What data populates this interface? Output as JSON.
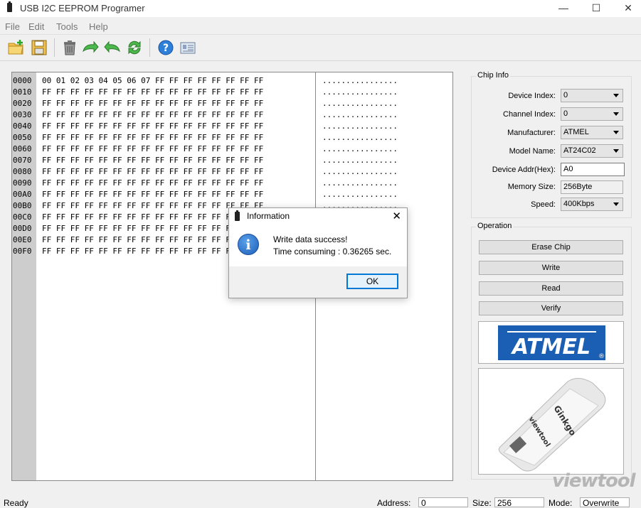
{
  "window": {
    "title": "USB I2C EEPROM Programer",
    "minimize": "—",
    "maximize": "☐",
    "close": "✕"
  },
  "menu": [
    "File",
    "Edit",
    "Tools",
    "Help"
  ],
  "toolbar_icons": [
    "open-folder-icon",
    "save-icon",
    "erase-icon",
    "write-icon",
    "read-icon",
    "verify-icon",
    "help-icon",
    "about-icon"
  ],
  "hex": {
    "addresses": [
      "0000",
      "0010",
      "0020",
      "0030",
      "0040",
      "0050",
      "0060",
      "0070",
      "0080",
      "0090",
      "00A0",
      "00B0",
      "00C0",
      "00D0",
      "00E0",
      "00F0"
    ],
    "rows": [
      "00 01 02 03 04 05 06 07 FF FF FF FF FF FF FF FF",
      "FF FF FF FF FF FF FF FF FF FF FF FF FF FF FF FF",
      "FF FF FF FF FF FF FF FF FF FF FF FF FF FF FF FF",
      "FF FF FF FF FF FF FF FF FF FF FF FF FF FF FF FF",
      "FF FF FF FF FF FF FF FF FF FF FF FF FF FF FF FF",
      "FF FF FF FF FF FF FF FF FF FF FF FF FF FF FF FF",
      "FF FF FF FF FF FF FF FF FF FF FF FF FF FF FF FF",
      "FF FF FF FF FF FF FF FF FF FF FF FF FF FF FF FF",
      "FF FF FF FF FF FF FF FF FF FF FF FF FF FF FF FF",
      "FF FF FF FF FF FF FF FF FF FF FF FF FF FF FF FF",
      "FF FF FF FF FF FF FF FF FF FF FF FF FF FF FF FF",
      "FF FF FF FF FF FF FF FF FF FF FF FF FF FF FF FF",
      "FF FF FF FF FF FF FF FF FF FF FF FF FF FF FF FF",
      "FF FF FF FF FF FF FF FF FF FF FF FF FF FF FF FF",
      "FF FF FF FF FF FF FF FF FF FF FF FF FF FF FF FF",
      "FF FF FF FF FF FF FF FF FF FF FF FF FF FF FF FF"
    ],
    "ascii": [
      "................",
      "................",
      "................",
      "................",
      "................",
      "................",
      "................",
      "................",
      "................",
      "................",
      "................",
      "................",
      "................",
      "................",
      "................",
      "................"
    ]
  },
  "chip_info": {
    "title": "Chip Info",
    "device_index": {
      "label": "Device Index:",
      "value": "0"
    },
    "channel_index": {
      "label": "Channel Index:",
      "value": "0"
    },
    "manufacturer": {
      "label": "Manufacturer:",
      "value": "ATMEL"
    },
    "model_name": {
      "label": "Model Name:",
      "value": "AT24C02"
    },
    "device_addr": {
      "label": "Device Addr(Hex):",
      "value": "A0"
    },
    "memory_size": {
      "label": "Memory Size:",
      "value": "256Byte"
    },
    "speed": {
      "label": "Speed:",
      "value": "400Kbps"
    }
  },
  "operation": {
    "title": "Operation",
    "erase": "Erase Chip",
    "write": "Write",
    "read": "Read",
    "verify": "Verify"
  },
  "logo": {
    "text": "ATMEL",
    "registered": "®"
  },
  "device_image": {
    "brand": "Ginkgo",
    "maker": "viewtool"
  },
  "dialog": {
    "title": "Information",
    "line1": "Write data success!",
    "line2": "Time consuming : 0.36265 sec.",
    "ok": "OK"
  },
  "status": {
    "ready": "Ready",
    "address_label": "Address:",
    "address_value": "0",
    "size_label": "Size:",
    "size_value": "256",
    "mode_label": "Mode:",
    "mode_value": "Overwrite"
  },
  "watermark": "viewtool",
  "colors": {
    "atmel_blue": "#1a5fb4",
    "dialog_accent": "#0078d7",
    "address_bg": "#cdcdcd"
  }
}
